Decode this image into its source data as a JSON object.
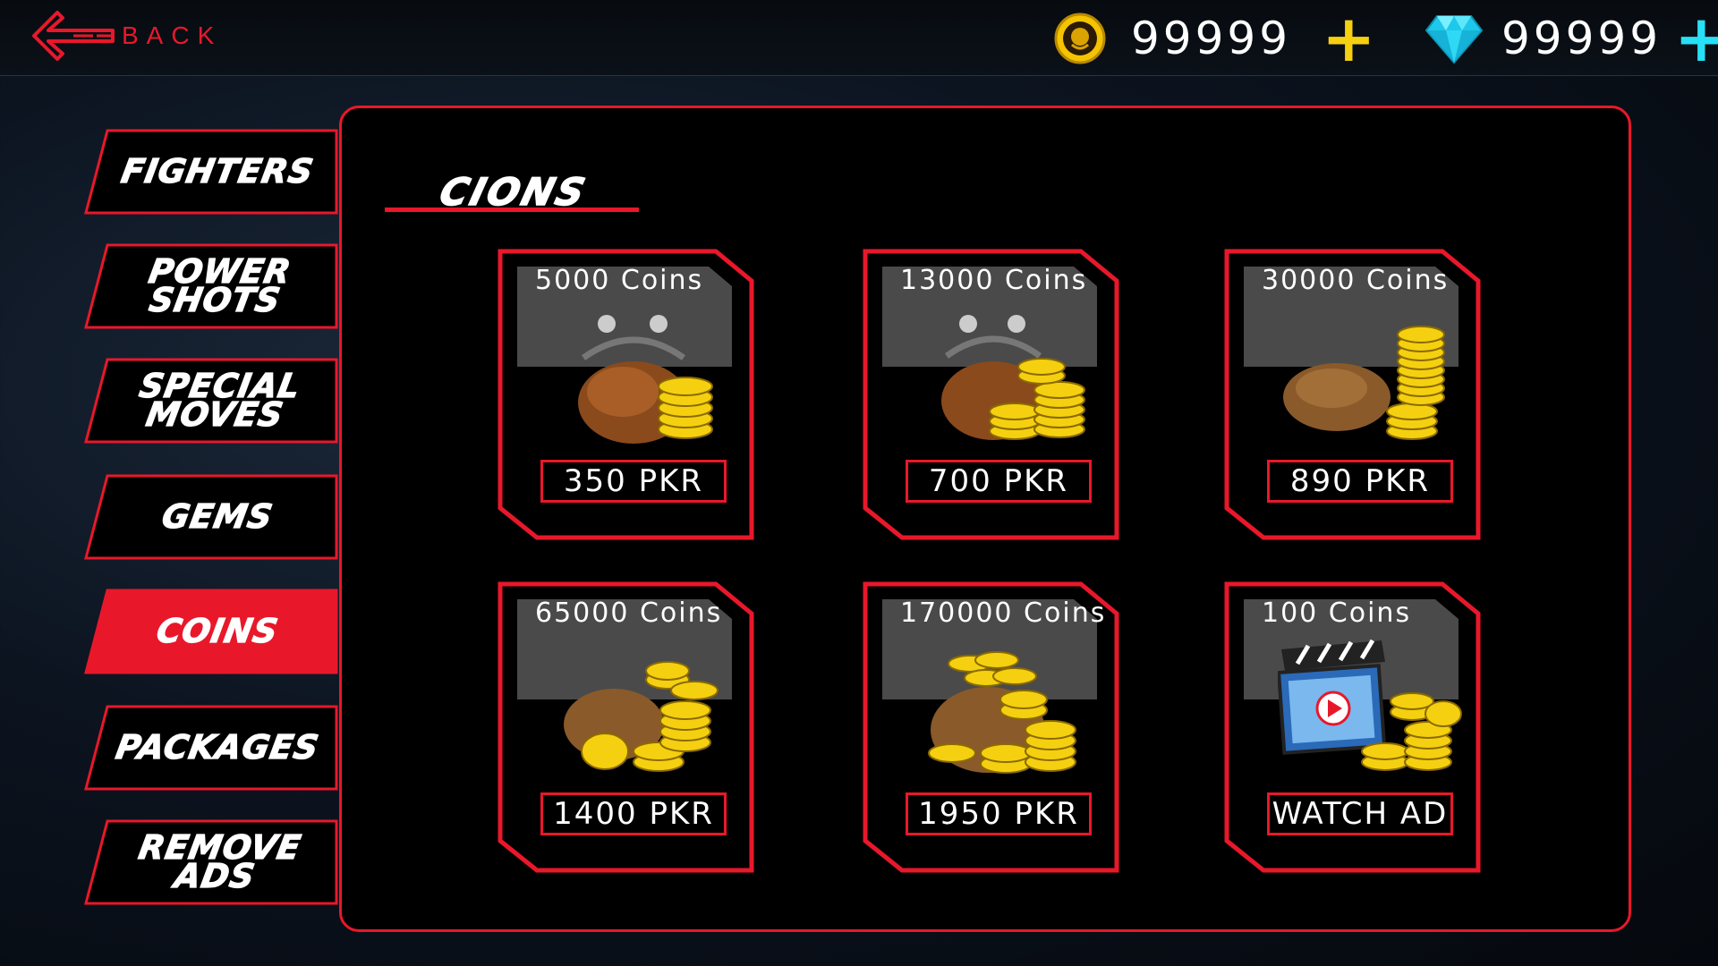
{
  "topbar": {
    "back_label": "BACK",
    "coins": {
      "amount": "99999",
      "plus": "+"
    },
    "gems": {
      "amount": "99999",
      "plus": "+"
    }
  },
  "sidebar": {
    "items": [
      {
        "label": "FIGHTERS",
        "active": false
      },
      {
        "label": "POWER\nSHOTS",
        "active": false
      },
      {
        "label": "SPECIAL\nMOVES",
        "active": false
      },
      {
        "label": "GEMS",
        "active": false
      },
      {
        "label": "COINS",
        "active": true
      },
      {
        "label": "PACKAGES",
        "active": false
      },
      {
        "label": "REMOVE\nADS",
        "active": false
      }
    ]
  },
  "section": {
    "title": "CIONS"
  },
  "offers": [
    {
      "title": "5000 Coins",
      "price": "350 PKR",
      "art": "purse-with-coins-icon"
    },
    {
      "title": "13000 Coins",
      "price": "700 PKR",
      "art": "purse-with-coin-stacks-icon"
    },
    {
      "title": "30000 Coins",
      "price": "890 PKR",
      "art": "sack-with-coin-stacks-icon"
    },
    {
      "title": "65000 Coins",
      "price": "1400 PKR",
      "art": "sack-with-coin-pile-icon"
    },
    {
      "title": "170000 Coins",
      "price": "1950 PKR",
      "art": "overflowing-sack-icon"
    },
    {
      "title": "100 Coins",
      "price": "WATCH AD",
      "art": "video-clapper-with-coins-icon"
    }
  ],
  "colors": {
    "accent_red": "#e8182a",
    "coin_gold": "#f5d010",
    "gem_cyan": "#26e0f6",
    "card_header_gray": "#4a4a4a"
  }
}
